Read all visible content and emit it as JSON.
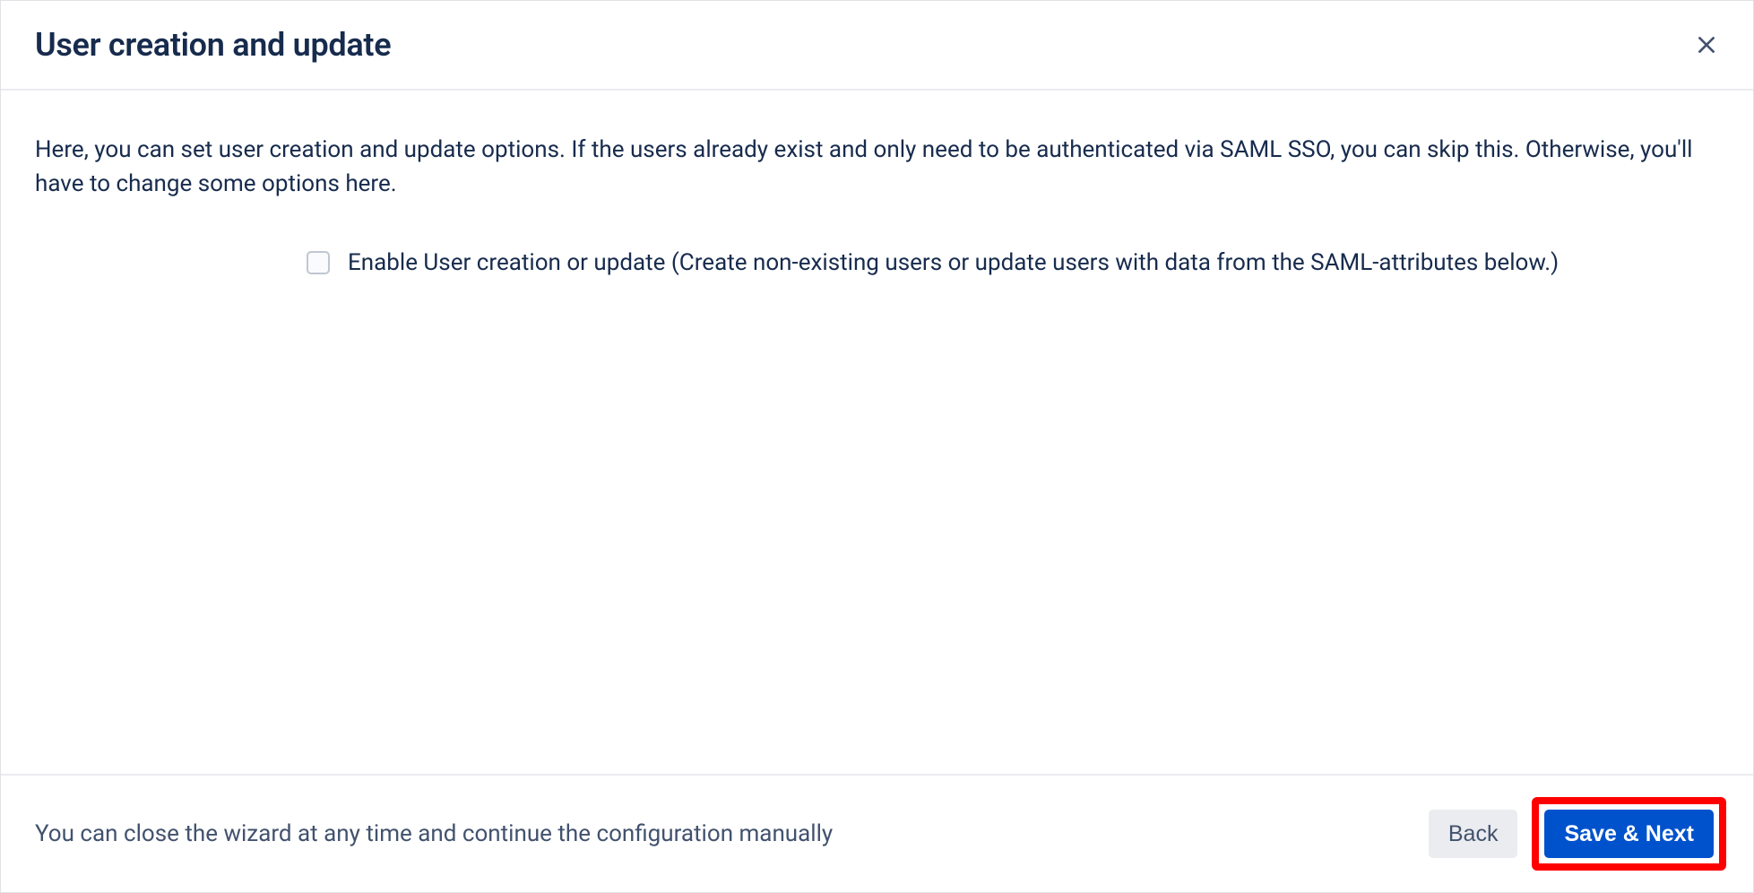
{
  "header": {
    "title": "User creation and update"
  },
  "body": {
    "description": "Here, you can set user creation and update options. If the users already exist and only need to be authenticated via SAML SSO, you can skip this. Otherwise, you'll have to change some options here.",
    "checkbox_label": "Enable User creation or update (Create non-existing users or update users with data from the SAML-attributes below.)"
  },
  "footer": {
    "hint": "You can close the wizard at any time and continue the configuration manually",
    "back_label": "Back",
    "save_next_label": "Save & Next"
  }
}
